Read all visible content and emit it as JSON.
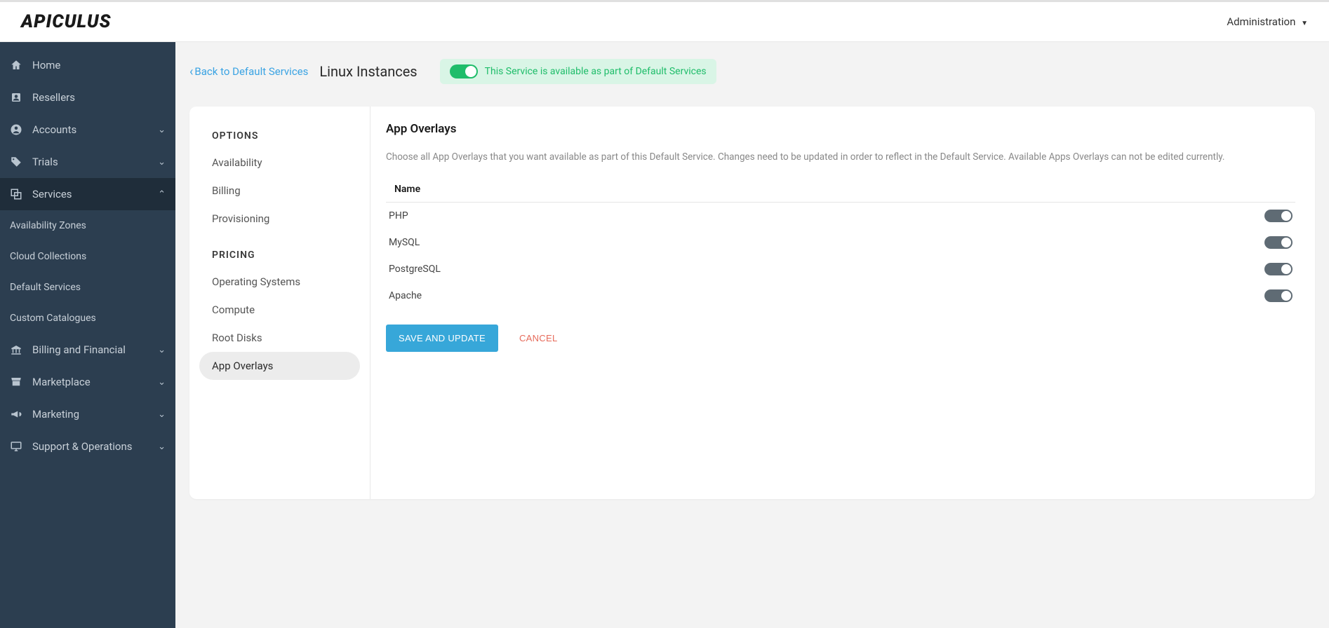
{
  "header": {
    "logo": "APICULUS",
    "admin_label": "Administration"
  },
  "sidebar": {
    "items": [
      {
        "label": "Home",
        "icon": "home"
      },
      {
        "label": "Resellers",
        "icon": "reseller"
      },
      {
        "label": "Accounts",
        "icon": "account",
        "expandable": true
      },
      {
        "label": "Trials",
        "icon": "tag",
        "expandable": true
      },
      {
        "label": "Services",
        "icon": "services",
        "expandable": true,
        "expanded": true,
        "children": [
          {
            "label": "Availability Zones"
          },
          {
            "label": "Cloud Collections"
          },
          {
            "label": "Default Services"
          },
          {
            "label": "Custom Catalogues"
          }
        ]
      },
      {
        "label": "Billing and Financial",
        "icon": "bank",
        "expandable": true
      },
      {
        "label": "Marketplace",
        "icon": "store",
        "expandable": true
      },
      {
        "label": "Marketing",
        "icon": "bullhorn",
        "expandable": true
      },
      {
        "label": "Support & Operations",
        "icon": "monitor",
        "expandable": true
      }
    ]
  },
  "page": {
    "back_label": "Back to Default Services",
    "title": "Linux Instances",
    "status_text": "This Service is available as part of Default Services"
  },
  "options": {
    "heading1": "OPTIONS",
    "group1": [
      {
        "label": "Availability"
      },
      {
        "label": "Billing"
      },
      {
        "label": "Provisioning"
      }
    ],
    "heading2": "PRICING",
    "group2": [
      {
        "label": "Operating Systems"
      },
      {
        "label": "Compute"
      },
      {
        "label": "Root Disks"
      },
      {
        "label": "App Overlays",
        "selected": true
      }
    ]
  },
  "main": {
    "title": "App Overlays",
    "description": "Choose all App Overlays that you want available as part of this Default Service. Changes need to be updated in order to reflect in the Default Service. Available Apps Overlays can not be edited currently.",
    "col_name": "Name",
    "rows": [
      {
        "name": "PHP",
        "enabled": false
      },
      {
        "name": "MySQL",
        "enabled": false
      },
      {
        "name": "PostgreSQL",
        "enabled": false
      },
      {
        "name": "Apache",
        "enabled": false
      }
    ],
    "save_label": "SAVE AND UPDATE",
    "cancel_label": "CANCEL"
  }
}
